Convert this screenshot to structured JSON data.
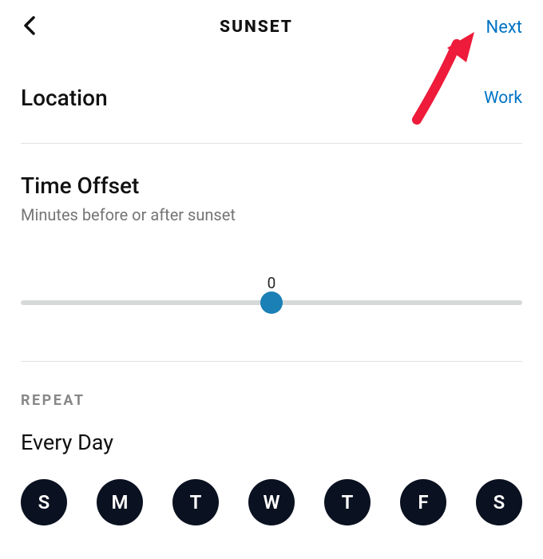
{
  "header": {
    "title": "SUNSET",
    "next_label": "Next"
  },
  "location": {
    "label": "Location",
    "value": "Work"
  },
  "offset": {
    "title": "Time Offset",
    "subtitle": "Minutes before or after sunset",
    "value": "0"
  },
  "repeat": {
    "header": "REPEAT",
    "value": "Every Day",
    "days": [
      "S",
      "M",
      "T",
      "W",
      "T",
      "F",
      "S"
    ]
  }
}
